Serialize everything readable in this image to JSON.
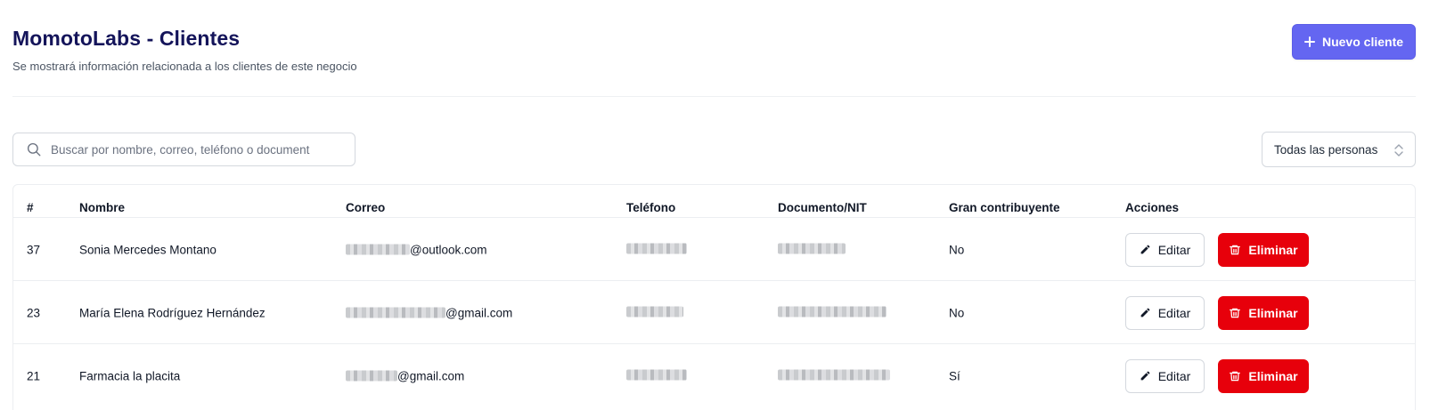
{
  "header": {
    "title": "MomotoLabs - Clientes",
    "subtitle": "Se mostrará información relacionada a los clientes de este negocio",
    "new_button_label": "Nuevo cliente"
  },
  "search": {
    "placeholder": "Buscar por nombre, correo, teléfono o document",
    "value": ""
  },
  "filter": {
    "selected": "Todas las personas"
  },
  "table": {
    "columns": [
      "#",
      "Nombre",
      "Correo",
      "Teléfono",
      "Documento/NIT",
      "Gran contribuyente",
      "Acciones"
    ],
    "rows": [
      {
        "id": "37",
        "name": "Sonia Mercedes Montano",
        "email_visible": "@outlook.com",
        "contributor": "No"
      },
      {
        "id": "23",
        "name": "María Elena Rodríguez Hernández",
        "email_visible": "@gmail.com",
        "contributor": "No"
      },
      {
        "id": "21",
        "name": "Farmacia la placita",
        "email_visible": "@gmail.com",
        "contributor": "Sí"
      }
    ],
    "edit_label": "Editar",
    "delete_label": "Eliminar"
  },
  "icons": {
    "new": "plus-icon",
    "search": "search-icon",
    "filter": "chevron-up-down-icon",
    "edit": "pencil-icon",
    "delete": "trash-icon"
  },
  "colors": {
    "title": "#14145a",
    "primary": "#6466f1",
    "danger": "#e7000b"
  }
}
